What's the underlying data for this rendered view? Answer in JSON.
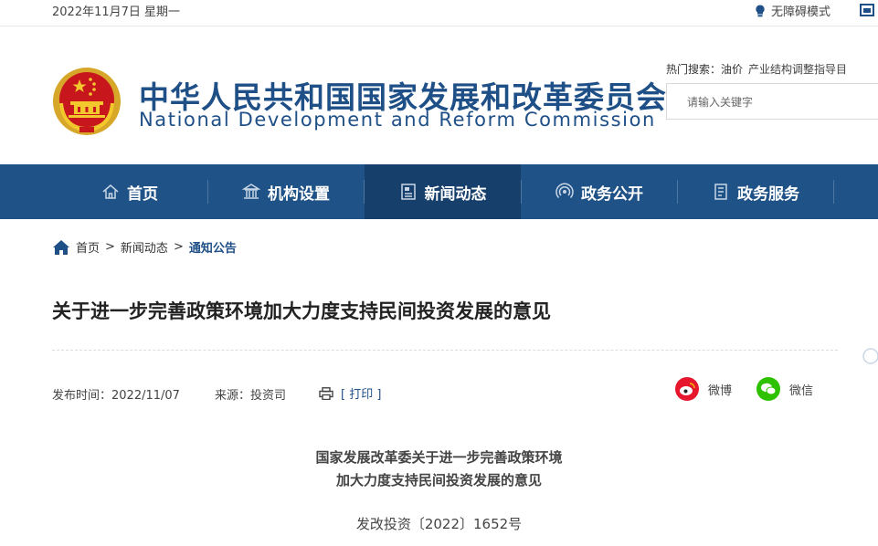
{
  "topbar": {
    "date": "2022年11月7日 星期一",
    "accessibility_label": "无障碍模式"
  },
  "header": {
    "title_cn": "中华人民共和国国家发展和改革委员会",
    "title_en": "National Development and Reform Commission",
    "hot_label": "热门搜索：",
    "hot_keywords": [
      "油价",
      "产业结构调整指导目"
    ],
    "search_placeholder": "请输入关键字"
  },
  "nav": {
    "items": [
      {
        "label": "首页",
        "icon": "home-icon"
      },
      {
        "label": "机构设置",
        "icon": "building-icon"
      },
      {
        "label": "新闻动态",
        "icon": "newspaper-icon"
      },
      {
        "label": "政务公开",
        "icon": "broadcast-icon"
      },
      {
        "label": "政务服务",
        "icon": "document-icon"
      }
    ],
    "active_index": 2
  },
  "breadcrumb": {
    "items": [
      "首页",
      "新闻动态",
      "通知公告"
    ],
    "separator": ">"
  },
  "article": {
    "title": "关于进一步完善政策环境加大力度支持民间投资发展的意见",
    "publish_time": "发布时间：2022/11/07",
    "source": "来源：投资司",
    "print_label": "[ 打印 ]",
    "share": {
      "weibo": "微博",
      "wechat": "微信"
    },
    "doc_title_line1": "国家发展改革委关于进一步完善政策环境",
    "doc_title_line2": "加大力度支持民间投资发展的意见",
    "doc_number": "发改投资〔2022〕1652号"
  },
  "colors": {
    "brand_blue": "#1f5287",
    "nav_active": "#173f6b",
    "weibo_red": "#e6162d",
    "wechat_green": "#2dc100"
  }
}
